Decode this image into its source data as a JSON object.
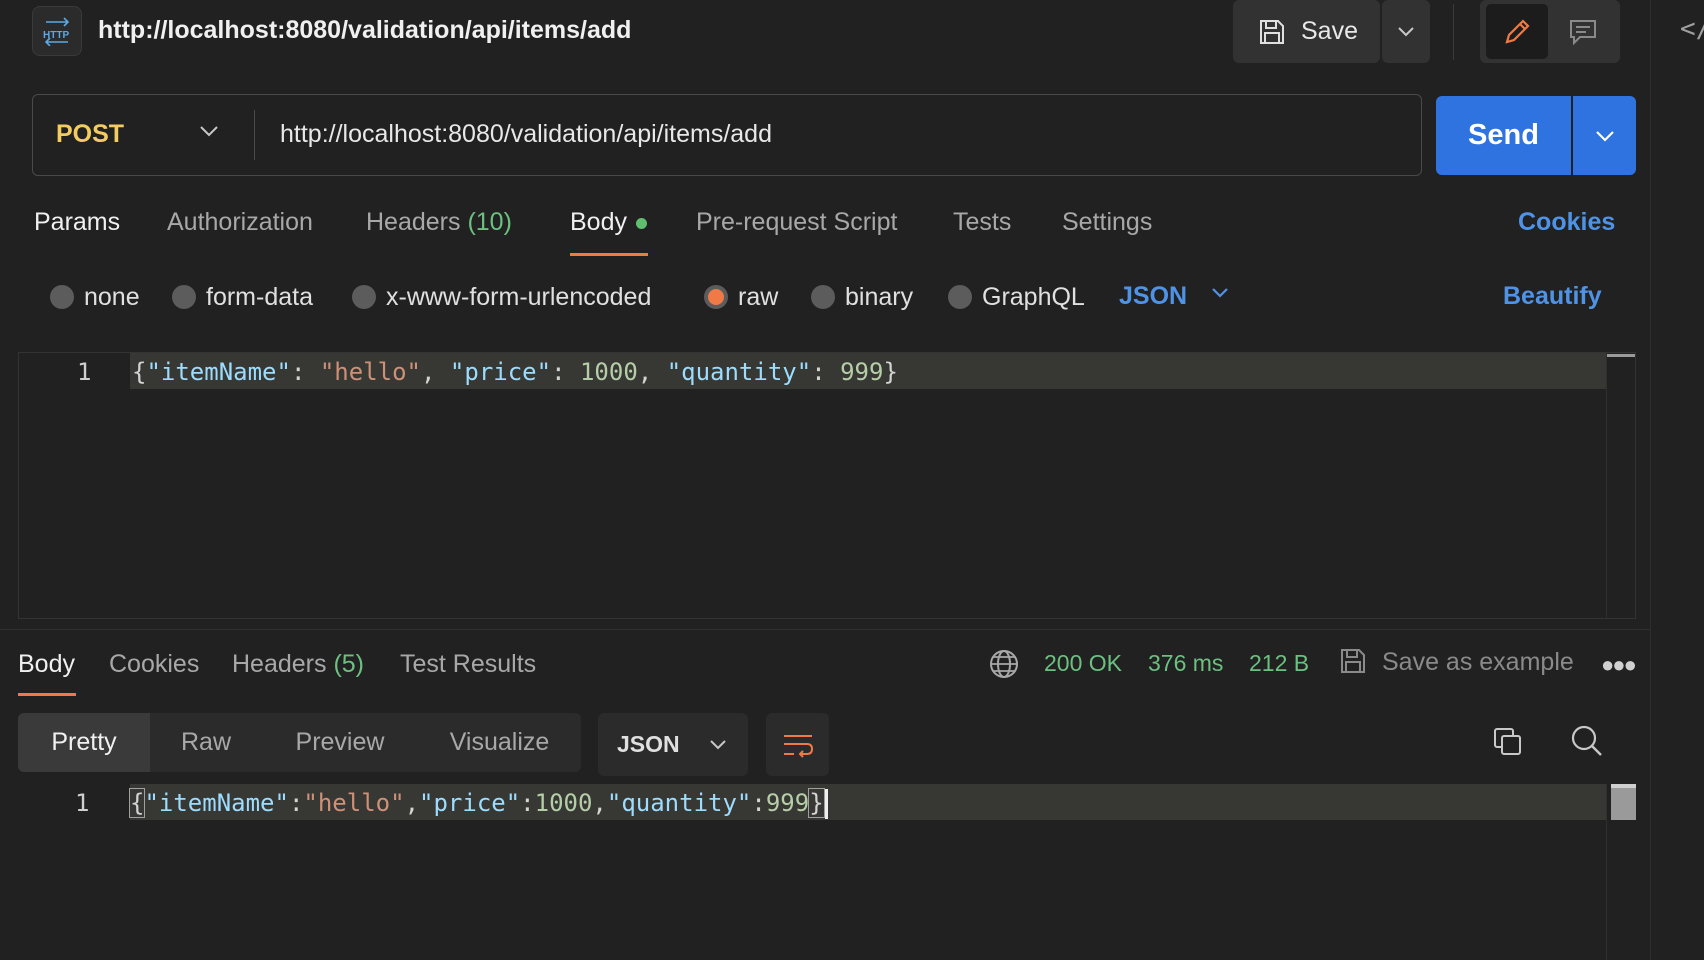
{
  "header": {
    "icon_label": "HTTP",
    "title": "http://localhost:8080/validation/api/items/add",
    "save_label": "Save"
  },
  "request": {
    "method": "POST",
    "url": "http://localhost:8080/validation/api/items/add",
    "send_label": "Send",
    "tabs": [
      {
        "label": "Params"
      },
      {
        "label": "Authorization"
      },
      {
        "label": "Headers",
        "count": "(10)"
      },
      {
        "label": "Body"
      },
      {
        "label": "Pre-request Script"
      },
      {
        "label": "Tests"
      },
      {
        "label": "Settings"
      }
    ],
    "cookies_label": "Cookies",
    "body_types": [
      "none",
      "form-data",
      "x-www-form-urlencoded",
      "raw",
      "binary",
      "GraphQL"
    ],
    "selected_body_type": "raw",
    "language": "JSON",
    "beautify_label": "Beautify",
    "editor": {
      "line_number": "1",
      "code": "{\"itemName\": \"hello\", \"price\": 1000, \"quantity\": 999}"
    }
  },
  "response": {
    "tabs": [
      {
        "label": "Body"
      },
      {
        "label": "Cookies"
      },
      {
        "label": "Headers",
        "count": "(5)"
      },
      {
        "label": "Test Results"
      }
    ],
    "status": "200 OK",
    "time": "376 ms",
    "size": "212 B",
    "save_example_label": "Save as example",
    "format_tabs": [
      "Pretty",
      "Raw",
      "Preview",
      "Visualize"
    ],
    "language": "JSON",
    "editor": {
      "line_number": "1",
      "code": "{\"itemName\":\"hello\",\"price\":1000,\"quantity\":999}"
    }
  },
  "colors": {
    "accent_orange": "#f07a45",
    "send_blue": "#2f73e0",
    "link_blue": "#4f93e6",
    "method_yellow": "#f2cc60",
    "success_green": "#6cc080"
  }
}
